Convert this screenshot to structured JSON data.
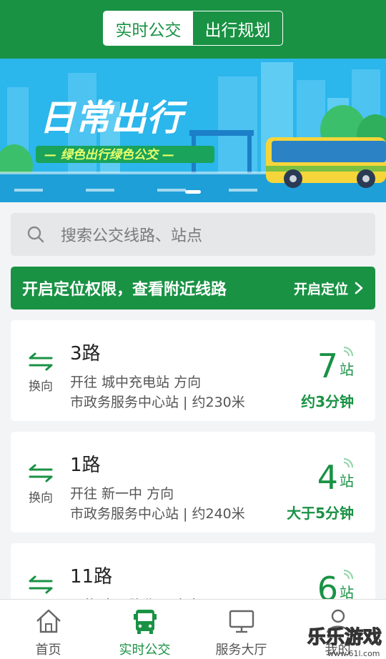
{
  "header": {
    "tabs": [
      {
        "label": "实时公交",
        "active": true
      },
      {
        "label": "出行规划",
        "active": false
      }
    ]
  },
  "banner": {
    "title": "日常出行",
    "subtitle": "— 绿色出行绿色公交 —"
  },
  "search": {
    "placeholder": "搜索公交线路、站点"
  },
  "location_prompt": {
    "text": "开启定位权限，查看附近线路",
    "button": "开启定位"
  },
  "routes": [
    {
      "swap_label": "换向",
      "name": "3路",
      "direction": "开往 城中充电站 方向",
      "stop": "市政务服务中心站 | 约230米",
      "stops_away": "7",
      "stops_unit": "站",
      "eta": "约3分钟"
    },
    {
      "swap_label": "换向",
      "name": "1路",
      "direction": "开往 新一中 方向",
      "stop": "市政务服务中心站 | 约240米",
      "stops_away": "4",
      "stops_unit": "站",
      "eta": "大于5分钟"
    },
    {
      "swap_label": "换向",
      "name": "11路",
      "direction": "开往 文运路北口 方向",
      "stop": "",
      "stops_away": "6",
      "stops_unit": "站",
      "eta": ""
    }
  ],
  "tabbar": {
    "items": [
      {
        "label": "首页",
        "icon": "home-icon",
        "active": false
      },
      {
        "label": "实时公交",
        "icon": "bus-icon",
        "active": true
      },
      {
        "label": "服务大厅",
        "icon": "monitor-icon",
        "active": false
      },
      {
        "label": "我的",
        "icon": "user-icon",
        "active": false
      }
    ]
  },
  "watermark": {
    "text": "乐乐游戏",
    "url": "www.61l.com"
  },
  "colors": {
    "primary": "#199244",
    "banner_sky": "#2bb6ec",
    "page_bg": "#f2f4f5"
  }
}
